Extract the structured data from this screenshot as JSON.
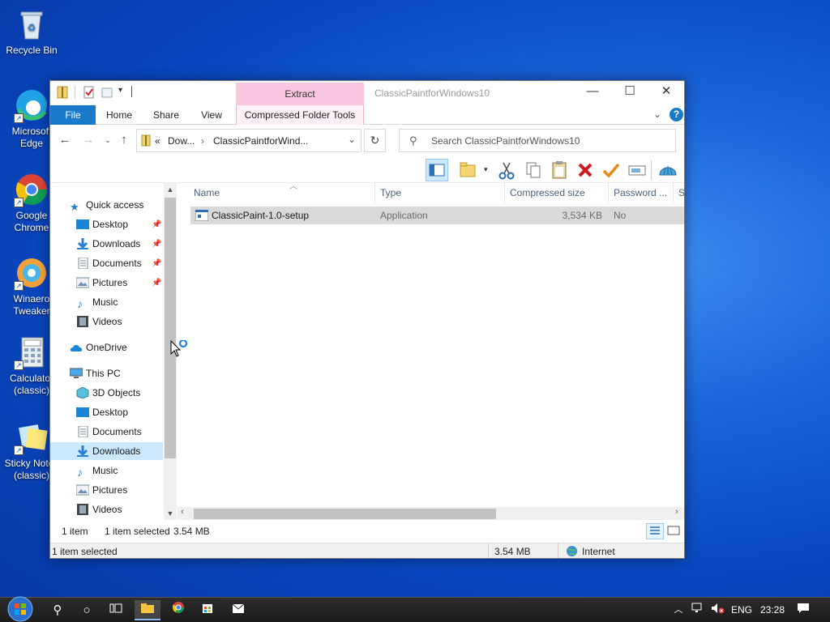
{
  "desktop": {
    "icons": [
      {
        "label": "Recycle Bin"
      },
      {
        "label": "Microsoft Edge"
      },
      {
        "label": "Google Chrome"
      },
      {
        "label": "Winaero Tweaker"
      },
      {
        "label": "Calculator (classic)"
      },
      {
        "label": "Sticky Notes (classic)"
      }
    ]
  },
  "window": {
    "title": "ClassicPaintforWindows10",
    "context_tab_header": "Extract",
    "controls": {
      "minimize": "—",
      "maximize": "☐",
      "close": "✕"
    },
    "ribbon": {
      "tabs": [
        "File",
        "Home",
        "Share",
        "View",
        "Compressed Folder Tools"
      ],
      "expand": "⌄",
      "help": "?"
    },
    "address": {
      "overflow": "«",
      "segments": [
        "Dow...",
        "ClassicPaintforWind..."
      ],
      "separator": "›",
      "dropdown": "⌄",
      "refresh": "↻"
    },
    "search": {
      "placeholder": "Search ClassicPaintforWindows10"
    },
    "navpane": {
      "quick_access": "Quick access",
      "quick_items": [
        "Desktop",
        "Downloads",
        "Documents",
        "Pictures",
        "Music",
        "Videos"
      ],
      "onedrive": "OneDrive",
      "this_pc": "This PC",
      "pc_items": [
        "3D Objects",
        "Desktop",
        "Documents",
        "Downloads",
        "Music",
        "Pictures",
        "Videos"
      ],
      "selected": "Downloads"
    },
    "columns": [
      "Name",
      "Type",
      "Compressed size",
      "Password ...",
      "Si"
    ],
    "files": [
      {
        "name": "ClassicPaint-1.0-setup",
        "type": "Application",
        "compressed_size": "3,534 KB",
        "password": "No"
      }
    ],
    "status": {
      "count": "1 item",
      "selection": "1 item selected",
      "size": "3.54 MB"
    },
    "bottom": {
      "selection": "1 item selected",
      "size": "3.54 MB",
      "zone": "Internet"
    }
  },
  "taskbar": {
    "language": "ENG",
    "time": "23:28"
  },
  "colors": {
    "accent": "#1979ca",
    "context_tab": "#f8c7df",
    "selection": "#cce8ff"
  }
}
